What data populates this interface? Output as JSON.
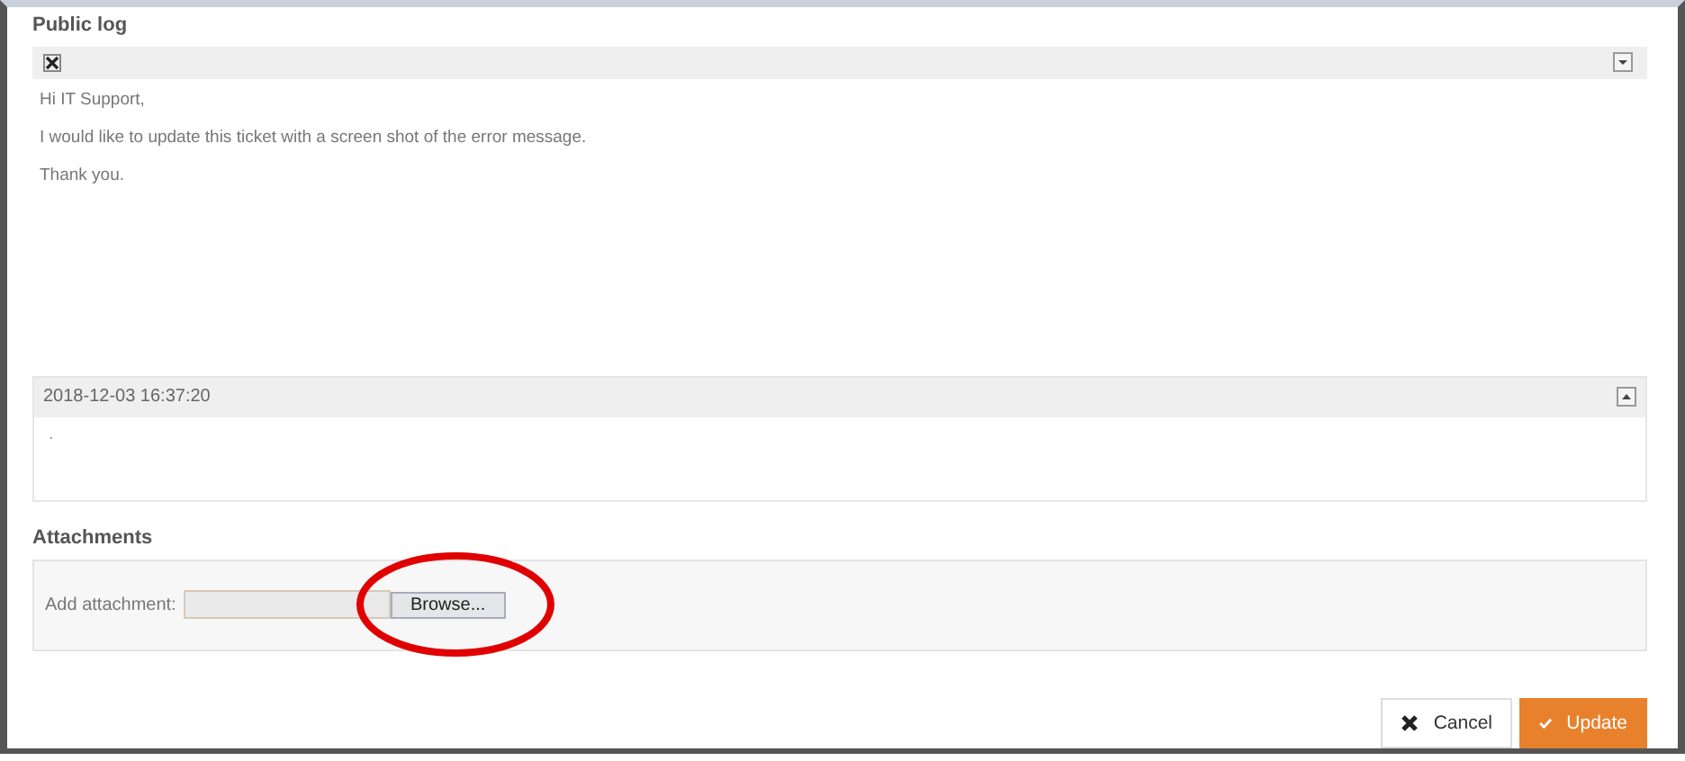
{
  "public_log": {
    "title": "Public log",
    "message": [
      "Hi IT Support,",
      "I would like to update this ticket with a screen shot of the error message.",
      "Thank you."
    ]
  },
  "log_entry": {
    "timestamp": "2018-12-03 16:37:20",
    "body": ".",
    "expanded": true
  },
  "attachments": {
    "title": "Attachments",
    "label": "Add attachment:",
    "browse_button": "Browse...",
    "highlighted": true
  },
  "buttons": [
    {
      "label": "Cancel",
      "kind": "cancel"
    },
    {
      "label": "Update",
      "kind": "primary"
    }
  ]
}
